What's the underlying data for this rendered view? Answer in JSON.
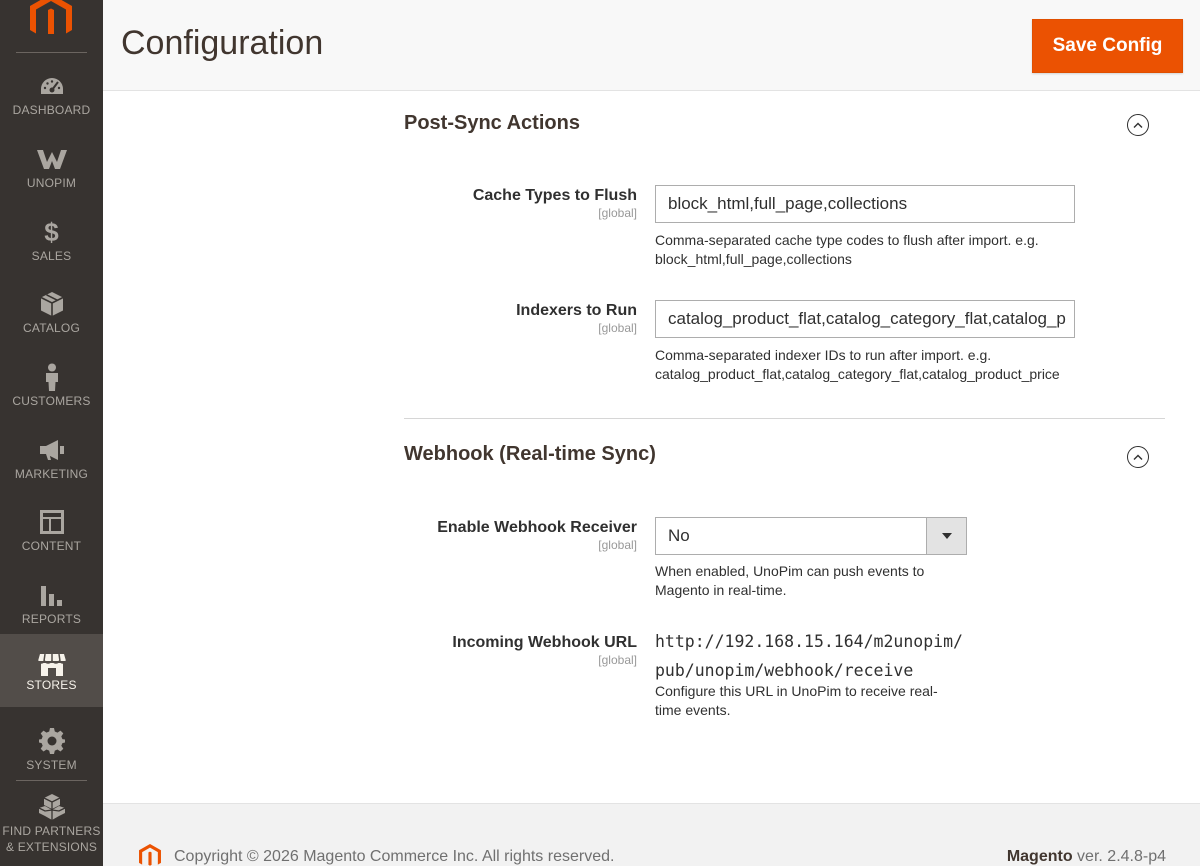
{
  "sidebar": {
    "items": [
      {
        "label": "DASHBOARD",
        "icon": "dashboard-icon"
      },
      {
        "label": "UNOPIM",
        "icon": "unopim-icon"
      },
      {
        "label": "SALES",
        "icon": "dollar-icon"
      },
      {
        "label": "CATALOG",
        "icon": "cube-icon"
      },
      {
        "label": "CUSTOMERS",
        "icon": "person-icon"
      },
      {
        "label": "MARKETING",
        "icon": "megaphone-icon"
      },
      {
        "label": "CONTENT",
        "icon": "layout-icon"
      },
      {
        "label": "REPORTS",
        "icon": "bar-chart-icon"
      },
      {
        "label": "STORES",
        "icon": "store-icon"
      },
      {
        "label": "SYSTEM",
        "icon": "gear-icon"
      },
      {
        "label_line1": "FIND PARTNERS",
        "label_line2": "& EXTENSIONS",
        "icon": "boxes-icon"
      }
    ],
    "active": "STORES"
  },
  "header": {
    "title": "Configuration",
    "save_label": "Save Config"
  },
  "sections": [
    {
      "title": "Post-Sync Actions",
      "fields": [
        {
          "label": "Cache Types to Flush",
          "scope": "[global]",
          "value": "block_html,full_page,collections",
          "note": "Comma-separated cache type codes to flush after import. e.g. block_html,full_page,collections"
        },
        {
          "label": "Indexers to Run",
          "scope": "[global]",
          "value": "catalog_product_flat,catalog_category_flat,catalog_p",
          "note": "Comma-separated indexer IDs to run after import. e.g. catalog_product_flat,catalog_category_flat,catalog_product_price"
        }
      ]
    },
    {
      "title": "Webhook (Real-time Sync)",
      "fields": [
        {
          "label": "Enable Webhook Receiver",
          "scope": "[global]",
          "value": "No",
          "note": "When enabled, UnoPim can push events to Magento in real-time."
        },
        {
          "label": "Incoming Webhook URL",
          "scope": "[global]",
          "value_line1": "http://192.168.15.164/m2unopim/",
          "value_line2": "pub/unopim/webhook/receive",
          "note": "Configure this URL in UnoPim to receive real-time events."
        }
      ]
    }
  ],
  "footer": {
    "copyright": "Copyright © 2026 Magento Commerce Inc. All rights reserved.",
    "brand": "Magento",
    "version": " ver. 2.4.8-p4"
  },
  "colors": {
    "accent": "#eb5202",
    "sidebar_bg": "#373330",
    "sidebar_active": "#524d49"
  }
}
